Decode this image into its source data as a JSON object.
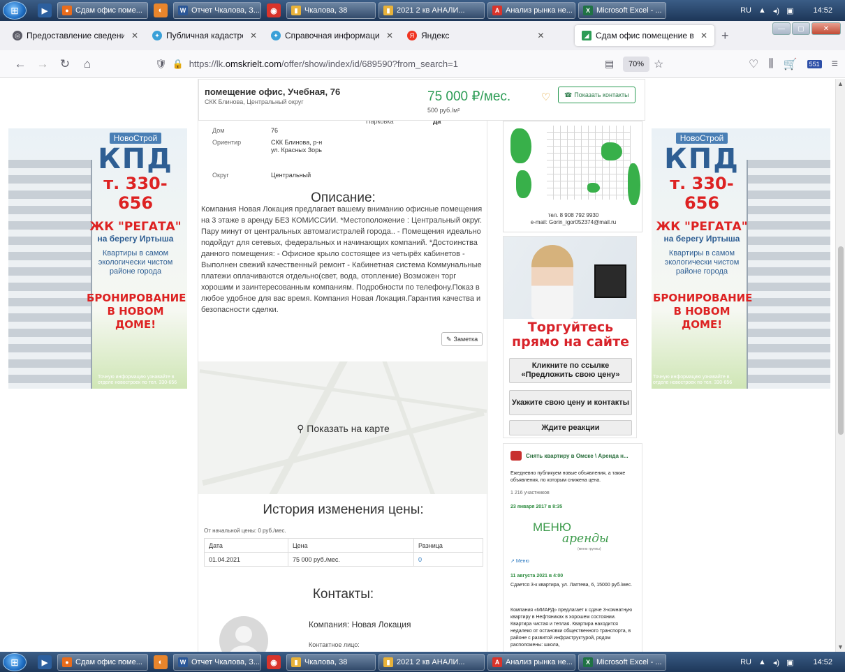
{
  "taskbar": {
    "items": [
      {
        "label": "Сдам офис поме...",
        "color": "#e86c1c"
      },
      {
        "label": "Отчет Чкалова, З...",
        "color": "#2b5797"
      },
      {
        "label": "Чкалова, 38",
        "color": "#e8b23a"
      },
      {
        "label": "2021 2 кв АНАЛИ...",
        "color": "#e8b23a"
      },
      {
        "label": "Анализ рынка не...",
        "color": "#d9342b"
      },
      {
        "label": "Microsoft Excel - ...",
        "color": "#1f7244"
      }
    ],
    "lang": "RU",
    "time": "14:52"
  },
  "browser": {
    "tabs": [
      {
        "label": "Предоставление сведений из",
        "color": "#5b5b66",
        "active": false
      },
      {
        "label": "Публичная кадастровая карта",
        "color": "#3aa0d8",
        "active": false
      },
      {
        "label": "Справочная информация по",
        "color": "#3aa0d8",
        "active": false
      },
      {
        "label": "Яндекс",
        "color": "#f03522",
        "active": false,
        "no_close": true
      },
      {
        "label": "Сдам офис помещение в Ом",
        "color": "#2c9c55",
        "active": true
      }
    ],
    "url_prefix": "https://lk.",
    "url_domain": "omskrielt.com",
    "url_path": "/offer/show/index/id/689590?from_search=1",
    "zoom": "70%",
    "badge": "551"
  },
  "header": {
    "title": "помещение офис, Учебная, 76",
    "subtitle": "СКК Блинова, Центральный округ",
    "price": "75 000 ₽/мес.",
    "price_per_m2": "500 руб./м²",
    "contacts_button": "Показать контакты",
    "cut_top": "Описание:",
    "cut_parking_label": "Парковка",
    "cut_parking_value": "Да"
  },
  "properties": [
    {
      "key": "Дом",
      "value": "76"
    },
    {
      "key": "Ориентир",
      "value": "СКК Блинова, р-н ул. Красных Зорь"
    },
    {
      "key": "Округ",
      "value": "Центральный"
    }
  ],
  "description": {
    "heading": "Описание:",
    "text": "Компания Новая Локация предлагает вашему вниманию офисные помещения на 3 этаже в аренду БЕЗ КОМИССИИ. *Местоположение : Центральный округ. Пару минут от центральных автомагистралей города.. - Помещения идеально подойдут для сетевых, федеральных и начинающих компаний. *Достоинства данного помещения: - Офисное крыло состоящее из четырёх кабинетов - Выполнен свежий качественный ремонт - Кабинетная система Коммунальные платежи оплачиваются отдельно(свет, вода, отопление) Возможен торг хорошим и заинтересованным компаниям. Подробности по телефону.Показ в любое удобное для вас время. Компания Новая Локация.Гарантия качества и безопасности сделки.",
    "note_button": "Заметка"
  },
  "map": {
    "label": "Показать на карте"
  },
  "price_history": {
    "heading": "История изменения цены:",
    "initial": "От начальной цены: 0 руб./мес.",
    "columns": [
      "Дата",
      "Цена",
      "Разница"
    ],
    "rows": [
      [
        "01.04.2021",
        "75 000 руб./мес.",
        "0"
      ]
    ]
  },
  "contacts": {
    "heading": "Контакты:",
    "company": "Компания: Новая Локация",
    "person_label": "Контактное лицо:"
  },
  "side_ad": {
    "logo": "НовоСтрой",
    "brand": "КПД",
    "phone": "т. 330-656",
    "project": "ЖК \"РЕГАТА\"",
    "project_sub": "на берегу Иртыша",
    "desc": "Квартиры в самом экологически чистом районе города",
    "cta": "БРОНИРОВАНИЕ В НОВОМ ДОМЕ!",
    "small": "Точную информацию узнавайте в отделе новостроек по тел. 330-656"
  },
  "plan_ad": {
    "phone": "тел. 8 908 792 9930",
    "email": "e-mail: Gorin_igor052374@mail.ru"
  },
  "trade_ad": {
    "title": "Торгуйтесь прямо на сайте",
    "step1": "Кликните по ссылке «Предложить свою цену»",
    "step2": "Укажите свою цену и контакты",
    "step3": "Ждите реакции"
  },
  "vk_widget": {
    "title": "Снять квартиру в Омске \\ Аренда н...",
    "desc": "Ежедневно публикуем новые объявления, а также объявления, по которым снижена цена.",
    "members": "1 216 участников",
    "date1": "23 января 2017 в 8:35",
    "menu_logo_a": "МЕНЮ",
    "menu_logo_b": "аренды",
    "menu_logo_c": "(меню группы)",
    "menu_link": "Меню",
    "date2": "11 августа 2021 в 4:00",
    "post_title": "Сдается 3-к квартира, ул. Лаптева, 6, 15000 руб./мес.",
    "post_text": "Компания «МИАРД» предлагает к сдаче 3-комнатную квартиру в Нефтяниках в хорошем состоянии. Квартира чистая и теплая. Квартира находится недалеко от остановки общественного транспорта, в районе с развитой инфраструктурой, рядом расположены: школа,"
  }
}
